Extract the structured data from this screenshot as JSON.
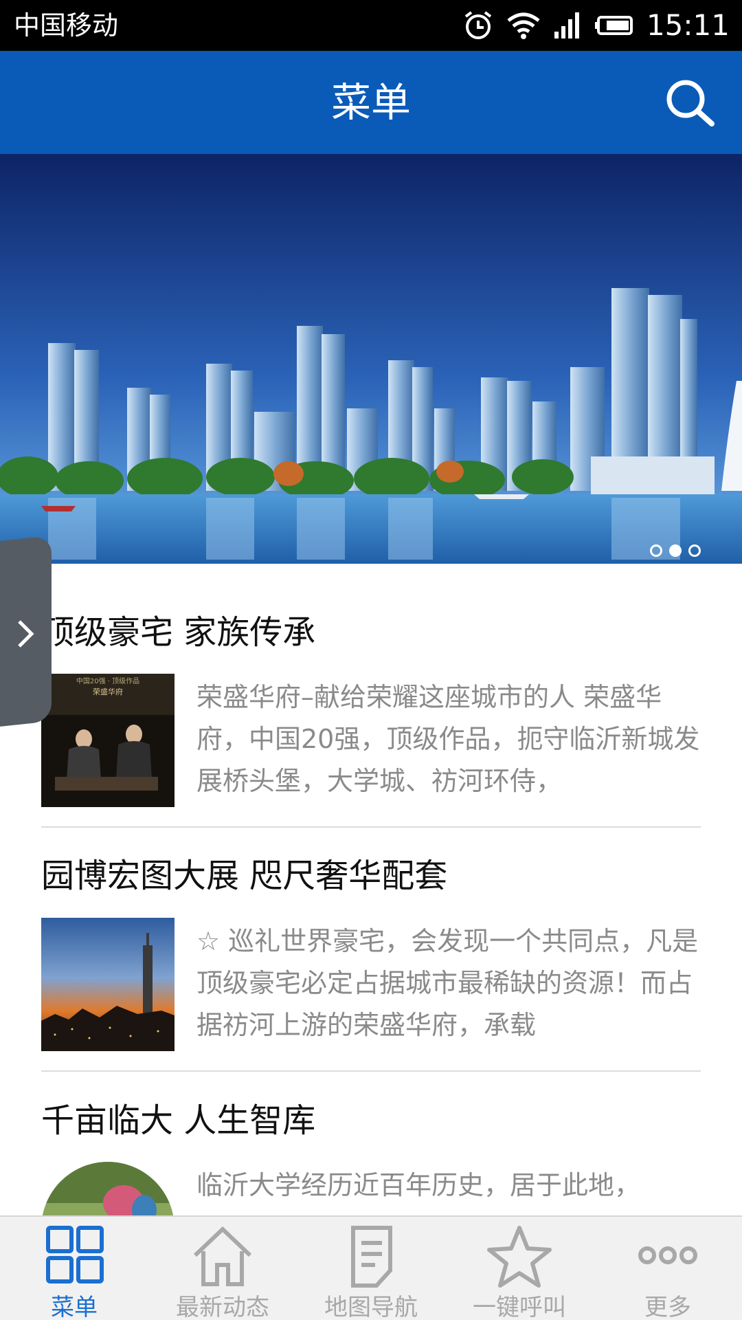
{
  "status_bar": {
    "carrier": "中国移动",
    "time": "15:11",
    "icons": [
      "alarm-icon",
      "wifi-icon",
      "signal-icon",
      "battery-icon"
    ]
  },
  "header": {
    "title": "菜单",
    "search_icon": "search-icon",
    "color": "#0a5bb8"
  },
  "banner": {
    "slide_count": 3,
    "active_slide": 2
  },
  "articles": [
    {
      "title": "顶级豪宅 家族传承",
      "description": "荣盛华府–献给荣耀这座城市的人 荣盛华府，中国20强，顶级作品，扼守临沂新城发展桥头堡，大学城、祊河环侍，",
      "thumb_caption": "中国20强 · 顶级作品\n荣盛华府"
    },
    {
      "title": "园博宏图大展 咫尺奢华配套",
      "description": "☆ 巡礼世界豪宅，会发现一个共同点，凡是顶级豪宅必定占据城市最稀缺的资源！而占据祊河上游的荣盛华府，承载"
    },
    {
      "title": "千亩临大 人生智库",
      "description": "临沂大学经历近百年历史，居于此地，"
    }
  ],
  "bottom_nav": [
    {
      "label": "菜单",
      "icon": "grid-icon",
      "active": true
    },
    {
      "label": "最新动态",
      "icon": "home-icon",
      "active": false
    },
    {
      "label": "地图导航",
      "icon": "document-icon",
      "active": false
    },
    {
      "label": "一键呼叫",
      "icon": "star-icon",
      "active": false
    },
    {
      "label": "更多",
      "icon": "more-icon",
      "active": false
    }
  ],
  "colors": {
    "accent": "#1a6fd1",
    "inactive": "#a8a8a8"
  }
}
